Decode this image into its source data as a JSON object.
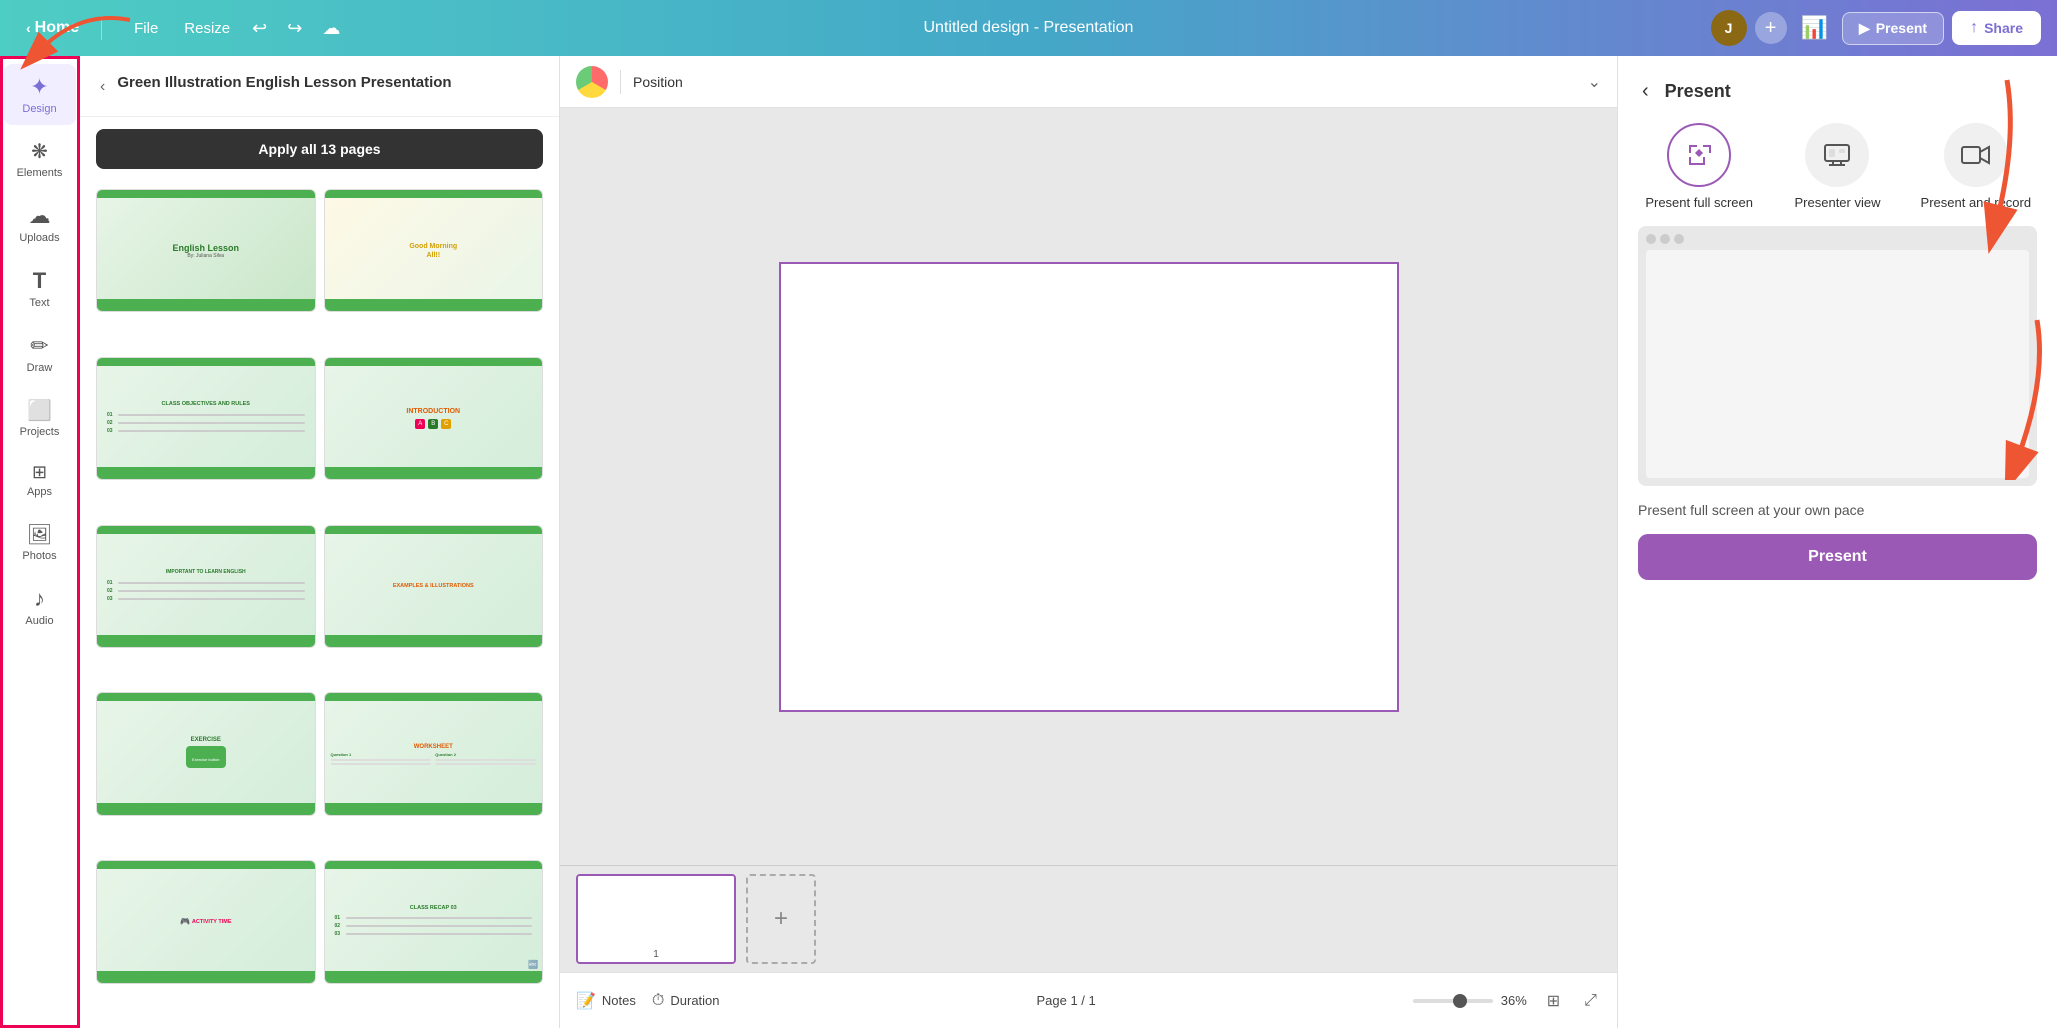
{
  "topbar": {
    "home_label": "Home",
    "file_label": "File",
    "resize_label": "Resize",
    "title": "Untitled design - Presentation",
    "present_btn": "Present",
    "share_btn": "Share"
  },
  "left_panel": {
    "template_title": "Green Illustration English Lesson Presentation",
    "apply_all_label": "Apply all 13 pages",
    "collapse_icon": "‹",
    "slides": [
      {
        "id": 1,
        "type": "cover",
        "label": "English Lesson",
        "sublabel": "By: Juliana Silva"
      },
      {
        "id": 2,
        "type": "goodmorning",
        "label": "Good Morning All!!"
      },
      {
        "id": 3,
        "type": "objectives",
        "label": "CLASS OBJECTIVES AND RULES"
      },
      {
        "id": 4,
        "type": "intro",
        "label": "INTRODUCTION"
      },
      {
        "id": 5,
        "type": "important",
        "label": "IMPORTANT TO LEARN ENGLISH"
      },
      {
        "id": 6,
        "type": "examples",
        "label": "EXAMPLES & ILLUSTRATIONS"
      },
      {
        "id": 7,
        "type": "exercise",
        "label": "EXERCISE"
      },
      {
        "id": 8,
        "type": "worksheet",
        "label": "WORKSHEET"
      },
      {
        "id": 9,
        "type": "activity",
        "label": "ACTIVITY TIME"
      },
      {
        "id": 10,
        "type": "recap",
        "label": "CLASS RECAP 03"
      }
    ]
  },
  "canvas": {
    "toolbar_label": "Position",
    "expand_icon": "⌄",
    "notes_label": "Notes",
    "duration_label": "Duration",
    "page_info": "Page 1 / 1",
    "zoom_value": "36%",
    "slide_number": "1"
  },
  "sidebar_icons": [
    {
      "id": "design",
      "icon": "✦",
      "label": "Design"
    },
    {
      "id": "elements",
      "icon": "⬡",
      "label": "Elements"
    },
    {
      "id": "uploads",
      "icon": "☁",
      "label": "Uploads"
    },
    {
      "id": "text",
      "icon": "T",
      "label": "Text"
    },
    {
      "id": "draw",
      "icon": "✏",
      "label": "Draw"
    },
    {
      "id": "projects",
      "icon": "⬜",
      "label": "Projects"
    },
    {
      "id": "apps",
      "icon": "⬛",
      "label": "Apps"
    },
    {
      "id": "photos",
      "icon": "🖼",
      "label": "Photos"
    },
    {
      "id": "audio",
      "icon": "♪",
      "label": "Audio"
    }
  ],
  "present_panel": {
    "back_icon": "‹",
    "title": "Present",
    "options": [
      {
        "id": "fullscreen",
        "icon": "↗",
        "label": "Present full screen"
      },
      {
        "id": "presenter",
        "icon": "⊟",
        "label": "Presenter view"
      },
      {
        "id": "record",
        "icon": "▭",
        "label": "Present and record"
      }
    ],
    "description": "Present full screen at your own pace",
    "action_label": "Present"
  }
}
